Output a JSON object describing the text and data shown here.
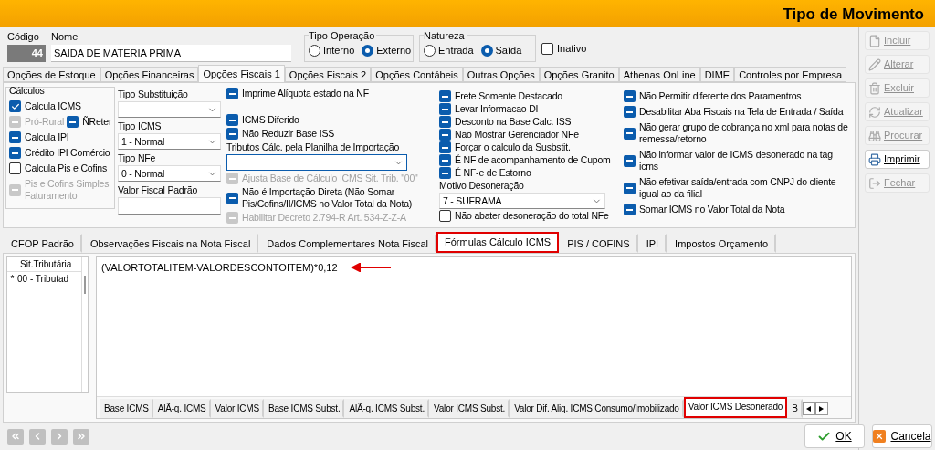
{
  "window": {
    "title": "Tipo de Movimento"
  },
  "header": {
    "codigo": {
      "label": "Código",
      "value": "44"
    },
    "nome": {
      "label": "Nome",
      "value": "SAIDA DE MATERIA PRIMA"
    },
    "tipo_operacao": {
      "label": "Tipo Operação",
      "options": [
        {
          "label": "Interno",
          "selected": false
        },
        {
          "label": "Externo",
          "selected": true
        }
      ]
    },
    "natureza": {
      "label": "Natureza",
      "options": [
        {
          "label": "Entrada",
          "selected": false
        },
        {
          "label": "Saída",
          "selected": true
        }
      ]
    },
    "inativo": {
      "label": "Inativo",
      "checked": false,
      "disabled": false
    }
  },
  "tabs": [
    {
      "label": "Opções de Estoque",
      "selected": false
    },
    {
      "label": "Opções Financeiras",
      "selected": false
    },
    {
      "label": "Opções Fiscais 1",
      "selected": true
    },
    {
      "label": "Opções Fiscais 2",
      "selected": false
    },
    {
      "label": "Opções Contábeis",
      "selected": false
    },
    {
      "label": "Outras Opções",
      "selected": false
    },
    {
      "label": "Opções Granito",
      "selected": false
    },
    {
      "label": "Athenas OnLine",
      "selected": false
    },
    {
      "label": "DIME",
      "selected": false
    },
    {
      "label": "Controles por Empresa",
      "selected": false
    }
  ],
  "calculos": {
    "title": "Cálculos",
    "rows": [
      [
        {
          "label": "Calcula ICMS",
          "checked": true,
          "disabled": false
        }
      ],
      [
        {
          "label": "Pró-Rural",
          "indeterminate": true,
          "disabled": true
        },
        {
          "label": "ÑReter",
          "indeterminate": true,
          "disabled": false
        }
      ],
      [
        {
          "label": "Calcula IPI",
          "indeterminate": true,
          "disabled": false
        }
      ],
      [
        {
          "label": "Crédito IPI Comércio",
          "indeterminate": true,
          "disabled": false
        }
      ],
      [
        {
          "label": "Calcula Pis e Cofins",
          "checked": false,
          "disabled": false
        }
      ],
      [
        {
          "label": "Pis e Cofins Simples Faturamento",
          "indeterminate": true,
          "disabled": true
        }
      ]
    ]
  },
  "column_2": [
    {
      "kind": "select",
      "label": "Tipo Substituição"
    },
    {
      "kind": "select",
      "label": "Tipo ICMS",
      "value": "1 - Normal"
    },
    {
      "kind": "select",
      "label": "Tipo NFe",
      "value": "0 - Normal"
    },
    {
      "kind": "input",
      "label": "Valor Fiscal Padrão"
    }
  ],
  "column_3": [
    {
      "kind": "checkbox",
      "label": "Imprime Alíquota estado na NF",
      "indeterminate": true,
      "disabled": false
    },
    {
      "kind": "spacer"
    },
    {
      "kind": "checkbox",
      "label": "ICMS Diferido",
      "indeterminate": true,
      "disabled": false
    },
    {
      "kind": "checkbox",
      "label": "Não Reduzir Base ISS",
      "indeterminate": true,
      "disabled": false
    },
    {
      "kind": "select",
      "label": "Tributos Cálc. pela Planilha de Importação",
      "focused": true
    },
    {
      "kind": "checkbox",
      "label": "Ajusta Base de Cálculo ICMS Sit. Trib. \"00\"",
      "indeterminate": true,
      "disabled": true
    },
    {
      "kind": "checkbox",
      "label": "Não é Importação Direta (Não Somar Pis/Cofins/II/ICMS  no Valor Total da Nota)",
      "indeterminate": true,
      "disabled": false
    },
    {
      "kind": "checkbox",
      "label": "Habilitar Decreto 2.794-R Art. 534-Z-Z-A",
      "indeterminate": true,
      "disabled": true
    }
  ],
  "column_4": [
    {
      "kind": "checkbox",
      "label": "Frete Somente Destacado",
      "indeterminate": true,
      "disabled": false
    },
    {
      "kind": "checkbox",
      "label": "Levar Informacao DI",
      "indeterminate": true,
      "disabled": false
    },
    {
      "kind": "checkbox",
      "label": "Desconto na Base Calc. ISS",
      "indeterminate": true,
      "disabled": false
    },
    {
      "kind": "checkbox",
      "label": "Não Mostrar Gerenciador NFe",
      "indeterminate": true,
      "disabled": false
    },
    {
      "kind": "checkbox",
      "label": "Forçar o calculo da Susbstit.",
      "indeterminate": true,
      "disabled": false
    },
    {
      "kind": "checkbox",
      "label": "É NF de acompanhamento de Cupom",
      "indeterminate": true,
      "disabled": false
    },
    {
      "kind": "checkbox",
      "label": "É NF-e de Estorno",
      "indeterminate": true,
      "disabled": false
    },
    {
      "kind": "select",
      "label": "Motivo Desoneração",
      "value": "7 - SUFRAMA"
    },
    {
      "kind": "checkbox",
      "label": "Não abater desoneração do total NFe",
      "checked": false,
      "disabled": false
    }
  ],
  "column_5": [
    {
      "kind": "checkbox",
      "label": "Não Permitir diferente dos Paramentros",
      "indeterminate": true,
      "disabled": false
    },
    {
      "kind": "checkbox",
      "label": "Desabilitar Aba Fiscais na Tela de Entrada / Saída",
      "indeterminate": true,
      "disabled": false
    },
    {
      "kind": "checkbox",
      "label": "Não gerar grupo de cobrança no xml para notas de remessa/retorno",
      "indeterminate": true,
      "disabled": false
    },
    {
      "kind": "checkbox",
      "label": "Não informar valor de ICMS desonerado na tag icms",
      "indeterminate": true,
      "disabled": false
    },
    {
      "kind": "checkbox",
      "label": "Não efetivar saída/entrada com CNPJ do cliente igual ao da filial",
      "indeterminate": true,
      "disabled": false
    },
    {
      "kind": "checkbox",
      "label": "Somar ICMS no Valor Total da Nota",
      "indeterminate": true,
      "disabled": false
    }
  ],
  "sub_tabs": [
    {
      "label": "CFOP Padrão",
      "selected": false,
      "highlighted": false
    },
    {
      "label": "Observações Fiscais na Nota Fiscal",
      "selected": false,
      "highlighted": false
    },
    {
      "label": "Dados Complementares Nota Fiscal",
      "selected": false,
      "highlighted": false
    },
    {
      "label": "Fórmulas Cálculo ICMS",
      "selected": true,
      "highlighted": true
    },
    {
      "label": "PIS / COFINS",
      "selected": false,
      "highlighted": false
    },
    {
      "label": "IPI",
      "selected": false,
      "highlighted": false
    },
    {
      "label": "Impostos Orçamento",
      "selected": false,
      "highlighted": false
    }
  ],
  "sit_grid": {
    "column": "Sit.Tributária",
    "rows": [
      {
        "marker": "*",
        "value": "00 - Tributad"
      }
    ]
  },
  "formula": {
    "text": "(VALORTOTALITEM-VALORDESCONTOITEM)*0,12",
    "annotation_arrow": true
  },
  "formula_tabs": [
    {
      "label": "Base ICMS",
      "selected": false,
      "highlighted": false
    },
    {
      "label": "AlÃ-q. ICMS",
      "selected": false,
      "highlighted": false
    },
    {
      "label": "Valor ICMS",
      "selected": false,
      "highlighted": false
    },
    {
      "label": "Base ICMS Subst.",
      "selected": false,
      "highlighted": false
    },
    {
      "label": "AlÃ-q. ICMS Subst.",
      "selected": false,
      "highlighted": false
    },
    {
      "label": "Valor ICMS Subst.",
      "selected": false,
      "highlighted": false
    },
    {
      "label": "Valor Dif. Aliq. ICMS Consumo/Imobilizado",
      "selected": false,
      "highlighted": false
    },
    {
      "label": "Valor ICMS Desonerado",
      "selected": true,
      "highlighted": true
    },
    {
      "label": "B",
      "selected": false,
      "highlighted": false
    }
  ],
  "side_buttons": [
    {
      "label": "Incluir",
      "disabled": true
    },
    {
      "label": "Alterar",
      "disabled": true
    },
    {
      "label": "Excluir",
      "disabled": true
    },
    {
      "label": "Atualizar",
      "disabled": true
    },
    {
      "label": "Procurar",
      "disabled": true
    },
    {
      "label": "Imprimir",
      "disabled": false
    },
    {
      "label": "Fechar",
      "disabled": true
    }
  ],
  "nav_buttons": [
    {
      "kind": "first",
      "disabled": true
    },
    {
      "kind": "prev",
      "disabled": true
    },
    {
      "kind": "next",
      "disabled": true
    },
    {
      "kind": "last",
      "disabled": true
    }
  ],
  "footer_buttons": [
    {
      "label": "OK",
      "kind": "ok"
    },
    {
      "label": "Cancela",
      "kind": "cancel"
    }
  ]
}
